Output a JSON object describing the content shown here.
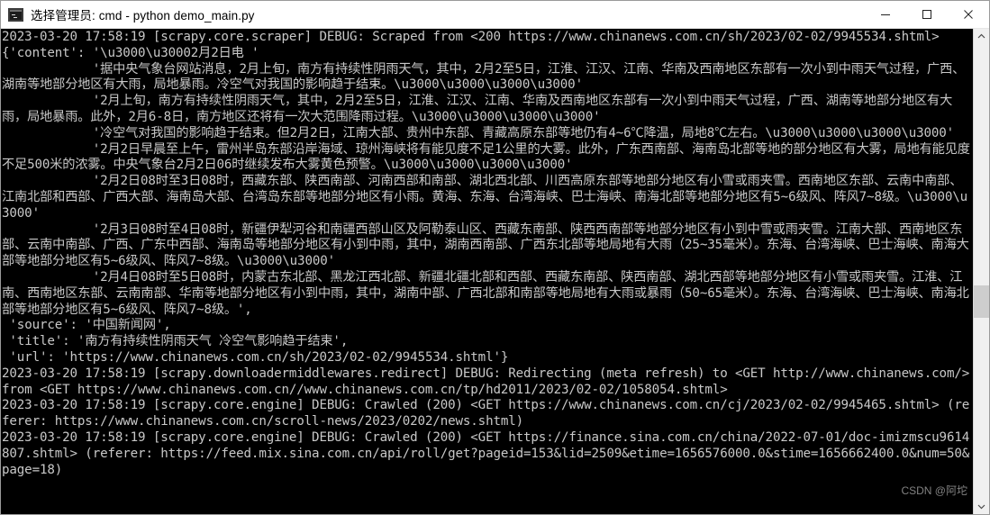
{
  "window": {
    "title": "选择管理员: cmd - python  demo_main.py",
    "icon": "console-icon",
    "controls": {
      "minimize_label": "—",
      "maximize_label": "□",
      "close_label": "✕"
    }
  },
  "terminal": {
    "prompt_background": "#000000",
    "text_color": "#c8c8c8",
    "lines": [
      "2023-03-20 17:58:19 [scrapy.core.scraper] DEBUG: Scraped from <200 https://www.chinanews.com.cn/sh/2023/02-02/9945534.shtml>",
      "{'content': '\\u3000\\u30002月2日电 '",
      "            '据中央气象台网站消息，2月上旬，南方有持续性阴雨天气，其中，2月2至5日，江淮、江汉、江南、华南及西南地区东部有一次小到中雨天气过程，广西、湖南等地部分地区有大雨，局地暴雨。冷空气对我国的影响趋于结束。\\u3000\\u3000\\u3000\\u3000'",
      "            '2月上旬，南方有持续性阴雨天气，其中，2月2至5日，江淮、江汉、江南、华南及西南地区东部有一次小到中雨天气过程，广西、湖南等地部分地区有大雨，局地暴雨。此外，2月6-8日，南方地区还将有一次大范围降雨过程。\\u3000\\u3000\\u3000\\u3000'",
      "            '冷空气对我国的影响趋于结束。但2月2日，江南大部、贵州中东部、青藏高原东部等地仍有4~6℃降温，局地8℃左右。\\u3000\\u3000\\u3000\\u3000'",
      "            '2月2日早晨至上午，雷州半岛东部沿岸海域、琼州海峡将有能见度不足1公里的大雾。此外，广东西南部、海南岛北部等地的部分地区有大雾，局地有能见度不足500米的浓雾。中央气象台2月2日06时继续发布大雾黄色预警。\\u3000\\u3000\\u3000\\u3000'",
      "            '2月2日08时至3日08时，西藏东部、陕西南部、河南西部和南部、湖北西北部、川西高原东部等地部分地区有小雪或雨夹雪。西南地区东部、云南中南部、江南北部和西部、广西大部、海南岛大部、台湾岛东部等地部分地区有小雨。黄海、东海、台湾海峡、巴士海峡、南海北部等地部分地区有5~6级风、阵风7~8级。\\u3000\\u3000'",
      "            '2月3日08时至4日08时，新疆伊犁河谷和南疆西部山区及阿勒泰山区、西藏东南部、陕西西南部等地部分地区有小到中雪或雨夹雪。江南大部、西南地区东部、云南中南部、广西、广东中西部、海南岛等地部分地区有小到中雨，其中，湖南西南部、广西东北部等地局地有大雨（25~35毫米）。东海、台湾海峡、巴士海峡、南海大部等地部分地区有5~6级风、阵风7~8级。\\u3000\\u3000'",
      "            '2月4日08时至5日08时，内蒙古东北部、黑龙江西北部、新疆北疆北部和西部、西藏东南部、陕西南部、湖北西部等地部分地区有小雪或雨夹雪。江淮、江南、西南地区东部、云南南部、华南等地部分地区有小到中雨，其中，湖南中部、广西北部和南部等地局地有大雨或暴雨（50~65毫米）。东海、台湾海峡、巴士海峡、南海北部等地部分地区有5~6级风、阵风7~8级。',",
      " 'source': '中国新闻网',",
      " 'title': '南方有持续性阴雨天气 冷空气影响趋于结束',",
      " 'url': 'https://www.chinanews.com.cn/sh/2023/02-02/9945534.shtml'}",
      "2023-03-20 17:58:19 [scrapy.downloadermiddlewares.redirect] DEBUG: Redirecting (meta refresh) to <GET http://www.chinanews.com/> from <GET https://www.chinanews.com.cn//www.chinanews.com.cn/tp/hd2011/2023/02-02/1058054.shtml>",
      "2023-03-20 17:58:19 [scrapy.core.engine] DEBUG: Crawled (200) <GET https://www.chinanews.com.cn/cj/2023/02-02/9945465.shtml> (referer: https://www.chinanews.com.cn/scroll-news/2023/0202/news.shtml)",
      "2023-03-20 17:58:19 [scrapy.core.engine] DEBUG: Crawled (200) <GET https://finance.sina.com.cn/china/2022-07-01/doc-imizmscu9614807.shtml> (referer: https://feed.mix.sina.com.cn/api/roll/get?pageid=153&lid=2509&etime=1656576000.0&stime=1656662400.0&num=50&page=18)"
    ]
  },
  "scrollbar": {
    "up_arrow": "chevron-up-icon",
    "down_arrow": "chevron-down-icon"
  },
  "watermark": {
    "text": "CSDN @阿坨"
  }
}
